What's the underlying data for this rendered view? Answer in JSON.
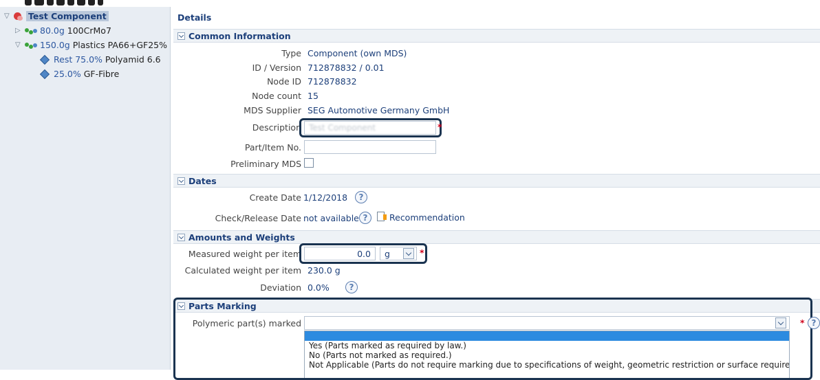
{
  "tree": {
    "root": {
      "label": "Test Component"
    },
    "items": [
      {
        "weight": "80.0g",
        "name": "100CrMo7"
      },
      {
        "weight": "150.0g",
        "name": "Plastics PA66+GF25%"
      },
      {
        "weight": "Rest 75.0%",
        "name": "Polyamid 6.6"
      },
      {
        "weight": "25.0%",
        "name": "GF-Fibre"
      }
    ]
  },
  "details": {
    "title": "Details",
    "common": {
      "heading": "Common Information",
      "type_label": "Type",
      "type_value": "Component (own MDS)",
      "id_label": "ID / Version",
      "id_value": "712878832 / 0.01",
      "node_label": "Node ID",
      "node_value": "712878832",
      "count_label": "Node count",
      "count_value": "15",
      "supplier_label": "MDS Supplier",
      "supplier_value": "SEG Automotive Germany GmbH",
      "description_label": "Description",
      "description_value": "Test Component",
      "part_label": "Part/Item No.",
      "part_value": "",
      "prelim_label": "Preliminary MDS"
    },
    "dates": {
      "heading": "Dates",
      "create_label": "Create Date",
      "create_value": "1/12/2018",
      "check_label": "Check/Release Date",
      "check_value": "not available",
      "recommendation": "Recommendation"
    },
    "amounts": {
      "heading": "Amounts and Weights",
      "measured_label": "Measured weight per item",
      "measured_value": "0.0",
      "measured_unit": "g",
      "calculated_label": "Calculated weight per item",
      "calculated_value": "230.0 g",
      "deviation_label": "Deviation",
      "deviation_value": "0.0%"
    },
    "parts": {
      "heading": "Parts Marking",
      "poly_label": "Polymeric part(s) marked",
      "options": [
        "Yes (Parts marked as required by law.)",
        "No (Parts not marked as required.)",
        "Not Applicable (Parts do not require marking due to specifications of weight, geometric restriction or surface requirements.)"
      ]
    },
    "help_symbol": "?",
    "required_symbol": "*"
  },
  "colors": {
    "accent": "#1c3f7a",
    "highlight_border": "#1a3350",
    "selection": "#2d8be0"
  }
}
